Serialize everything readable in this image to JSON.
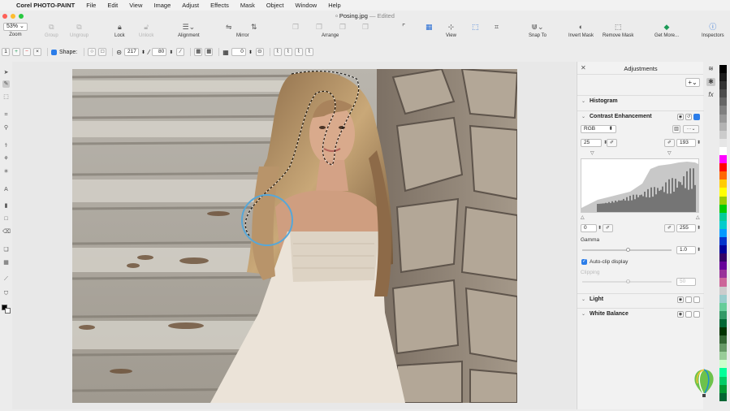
{
  "menubar": {
    "app_name": "Corel PHOTO-PAINT",
    "items": [
      "File",
      "Edit",
      "View",
      "Image",
      "Adjust",
      "Effects",
      "Mask",
      "Object",
      "Window",
      "Help"
    ]
  },
  "title": {
    "filename": "Posing.jpg",
    "status": "Edited"
  },
  "toolbar": {
    "zoom_value": "53%",
    "zoom": "Zoom",
    "group": "Group",
    "ungroup": "Ungroup",
    "lock": "Lock",
    "unlock": "Unlock",
    "alignment": "Alignment",
    "mirror": "Mirror",
    "arrange": "Arrange",
    "view": "View",
    "snap_to": "Snap To",
    "invert_mask": "Invert Mask",
    "remove_mask": "Remove Mask",
    "get_more": "Get More...",
    "inspectors": "Inspectors"
  },
  "propbar": {
    "shape_label": "Shape:",
    "size": "217",
    "transparency": "80",
    "rotate": "0"
  },
  "adjustments": {
    "title": "Adjustments",
    "histogram": "Histogram",
    "contrast_enhancement": "Contrast Enhancement",
    "channel": "RGB",
    "input_low": "25",
    "input_high": "193",
    "output_low": "0",
    "output_high": "255",
    "gamma_label": "Gamma",
    "gamma_value": "1.0",
    "auto_clip": "Auto-clip display",
    "clipping_label": "Clipping",
    "clipping_value": "50",
    "light": "Light",
    "white_balance": "White Balance"
  },
  "colors": {
    "accent": "#2b7de9",
    "palette": [
      "#000000",
      "#1a1a1a",
      "#333333",
      "#4d4d4d",
      "#666666",
      "#808080",
      "#999999",
      "#b3b3b3",
      "#cccccc",
      "#e6e6e6",
      "#ffffff",
      "#ff00ff",
      "#ff0000",
      "#ff6600",
      "#ffcc00",
      "#ffff00",
      "#99cc00",
      "#00cc00",
      "#00cc99",
      "#00cccc",
      "#0099ff",
      "#0033cc",
      "#000099",
      "#330066",
      "#660099",
      "#993399",
      "#cc6699",
      "#cccccc",
      "#99cccc",
      "#66cc99",
      "#339966",
      "#006633",
      "#003300",
      "#336633",
      "#669966",
      "#99cc99",
      "#ccffcc",
      "#00ff99",
      "#00cc66",
      "#009933",
      "#006633"
    ]
  }
}
